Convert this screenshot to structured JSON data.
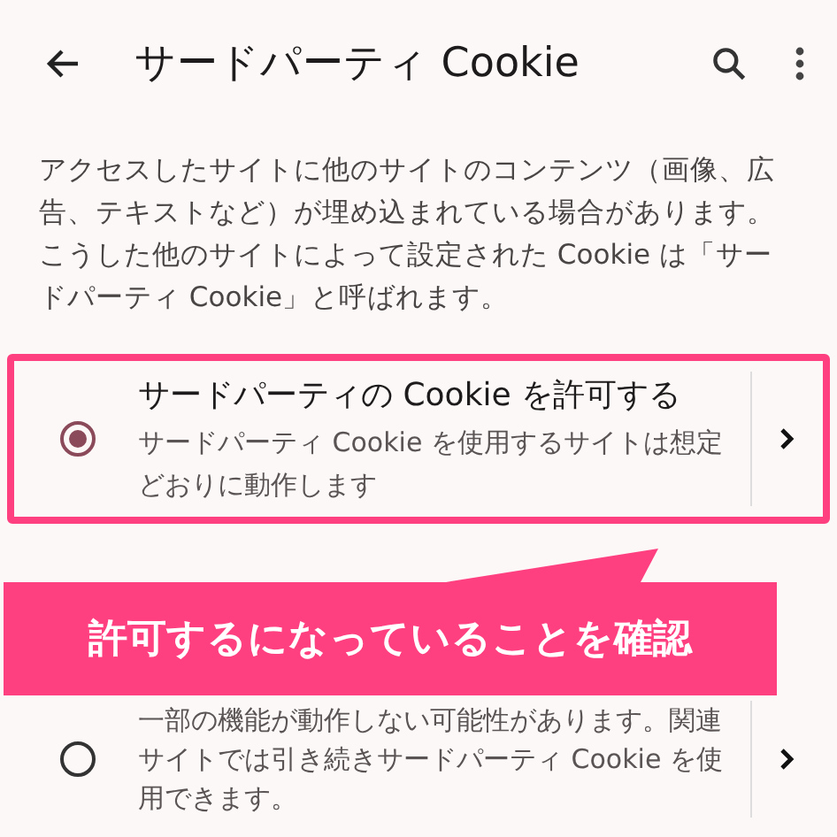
{
  "header": {
    "title": "サードパーティ Cookie"
  },
  "description": "アクセスしたサイトに他のサイトのコンテンツ（画像、広告、テキストなど）が埋め込まれている場合があります。こうした他のサイトによって設定された Cookie は「サードパーティ Cookie」と呼ばれます。",
  "options": [
    {
      "title": "サードパーティの Cookie を許可する",
      "description": "サードパーティ Cookie を使用するサイトは想定どおりに動作します",
      "selected": true,
      "highlighted": true
    },
    {
      "description": "一部の機能が動作しない可能性があります。関連サイトでは引き続きサードパーティ Cookie を使用できます。",
      "selected": false,
      "highlighted": false
    }
  ],
  "callout": {
    "text": "許可するになっていることを確認"
  }
}
